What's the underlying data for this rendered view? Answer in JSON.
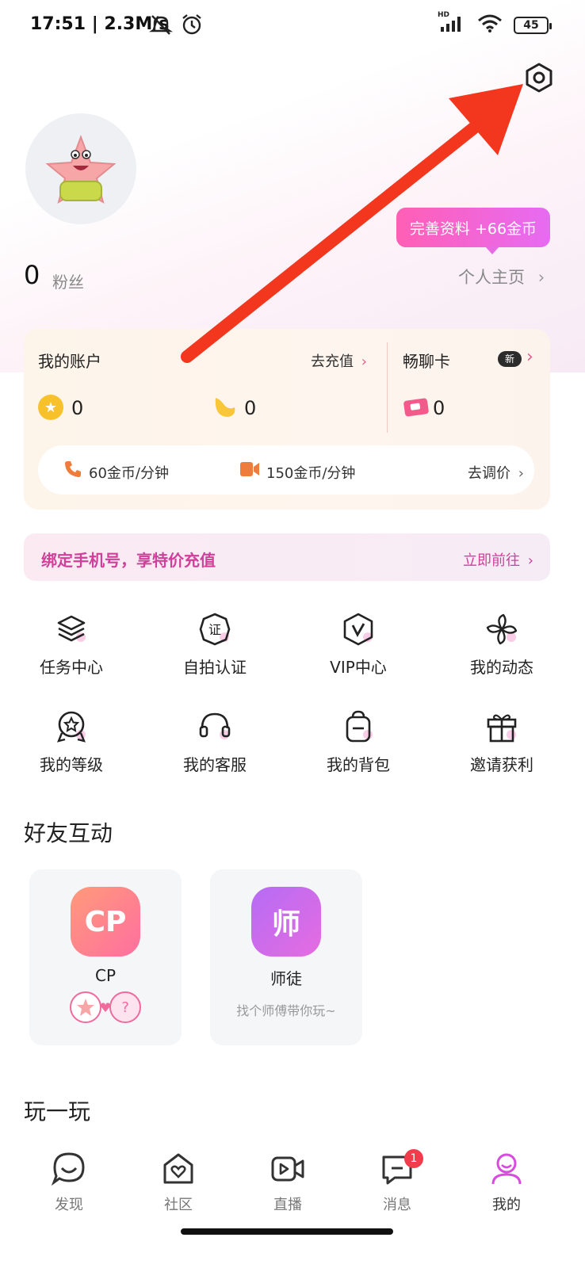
{
  "status_bar": {
    "time": "17:51 | 2.3M/s",
    "battery": "45",
    "hd": "HD"
  },
  "profile": {
    "fans_count": "0",
    "fans_label": "粉丝",
    "homepage_link": "个人主页",
    "complete_tip": "完善资料 +66金币"
  },
  "account": {
    "title": "我的账户",
    "recharge": "去充值",
    "coin_value": "0",
    "bean_value": "0",
    "chat_card_title": "畅聊卡",
    "new_badge": "新",
    "chat_card_value": "0",
    "voice_price": "60金币/分钟",
    "video_price": "150金币/分钟",
    "adjust_price": "去调价"
  },
  "bind_banner": {
    "text": "绑定手机号，享特价充值",
    "go": "立即前往"
  },
  "grid": [
    {
      "label": "任务中心",
      "icon": "layers-icon"
    },
    {
      "label": "自拍认证",
      "icon": "certificate-icon"
    },
    {
      "label": "VIP中心",
      "icon": "vip-icon"
    },
    {
      "label": "我的动态",
      "icon": "pinwheel-icon"
    },
    {
      "label": "我的等级",
      "icon": "star-badge-icon"
    },
    {
      "label": "我的客服",
      "icon": "headset-icon"
    },
    {
      "label": "我的背包",
      "icon": "backpack-icon"
    },
    {
      "label": "邀请获利",
      "icon": "gift-icon"
    }
  ],
  "friends_section": {
    "title": "好友互动",
    "cards": [
      {
        "icon_text": "CP",
        "title": "CP",
        "color_from": "#ff8a7a",
        "color_to": "#ff6fa0"
      },
      {
        "icon_text": "师",
        "title": "师徒",
        "subtitle": "找个师傅带你玩~",
        "color_from": "#c46cf0",
        "color_to": "#e06ce6"
      }
    ]
  },
  "play_section": {
    "title": "玩一玩"
  },
  "tab_bar": [
    {
      "label": "发现",
      "icon": "smile-bubble-icon"
    },
    {
      "label": "社区",
      "icon": "heart-house-icon"
    },
    {
      "label": "直播",
      "icon": "video-play-icon"
    },
    {
      "label": "消息",
      "icon": "message-icon",
      "badge": "1"
    },
    {
      "label": "我的",
      "icon": "profile-icon",
      "active": true
    }
  ],
  "colors": {
    "accent_pink": "#e64ca8",
    "arrow_red": "#f2371e"
  }
}
